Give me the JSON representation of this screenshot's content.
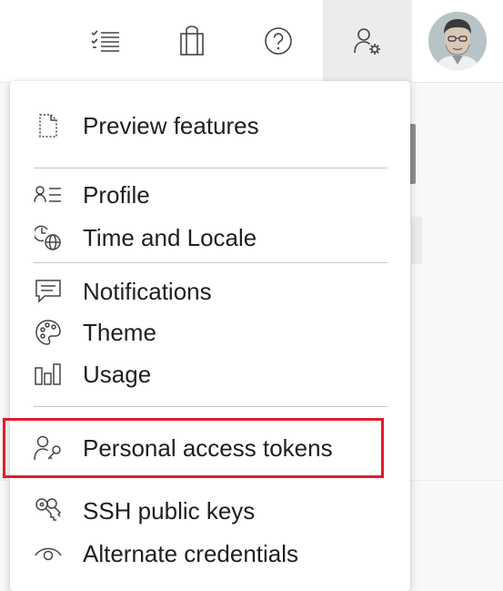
{
  "header": {
    "buttons": [
      {
        "icon": "task-list-icon",
        "label": "Work items"
      },
      {
        "icon": "shopping-bag-icon",
        "label": "Marketplace"
      },
      {
        "icon": "help-icon",
        "label": "Help"
      },
      {
        "icon": "user-settings-icon",
        "label": "User settings"
      }
    ],
    "avatar_icon": "avatar"
  },
  "menu": {
    "sections": [
      {
        "items": [
          {
            "icon": "preview-features-icon",
            "label": "Preview features"
          }
        ]
      },
      {
        "items": [
          {
            "icon": "profile-icon",
            "label": "Profile"
          },
          {
            "icon": "time-locale-icon",
            "label": "Time and Locale"
          }
        ]
      },
      {
        "items": [
          {
            "icon": "notifications-icon",
            "label": "Notifications"
          },
          {
            "icon": "theme-icon",
            "label": "Theme"
          },
          {
            "icon": "usage-icon",
            "label": "Usage"
          }
        ]
      },
      {
        "items": [
          {
            "icon": "personal-access-tokens-icon",
            "label": "Personal access tokens",
            "highlighted": true
          },
          {
            "icon": "ssh-keys-icon",
            "label": "SSH public keys"
          },
          {
            "icon": "alternate-credentials-icon",
            "label": "Alternate credentials"
          }
        ]
      }
    ]
  },
  "colors": {
    "highlight_outline": "#e21b2c",
    "text": "#201f1e",
    "separator": "#c8c6c4"
  }
}
